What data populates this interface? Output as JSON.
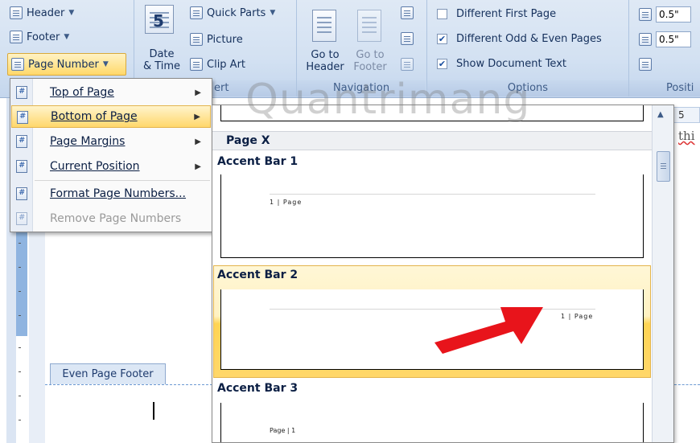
{
  "ribbon": {
    "header_label": "Header",
    "footer_label": "Footer",
    "page_number_label": "Page Number",
    "date_time_label_1": "Date",
    "date_time_label_2": "& Time",
    "date_icon_text": "5",
    "quick_parts_label": "Quick Parts",
    "picture_label": "Picture",
    "clip_art_label": "Clip Art",
    "insert_group_label": "ert",
    "go_to_header_label_1": "Go to",
    "go_to_header_label_2": "Header",
    "go_to_footer_label_1": "Go to",
    "go_to_footer_label_2": "Footer",
    "navigation_group_label": "Navigation",
    "options": [
      {
        "label": "Different First Page",
        "checked": false
      },
      {
        "label": "Different Odd & Even Pages",
        "checked": true
      },
      {
        "label": "Show Document Text",
        "checked": true
      }
    ],
    "options_group_label": "Options",
    "header_position_value": "0.5\"",
    "footer_position_value": "0.5\"",
    "position_group_label": "Positi"
  },
  "menu": {
    "items": [
      {
        "label": "Top of Page",
        "submenu": true,
        "disabled": false
      },
      {
        "label": "Bottom of Page",
        "submenu": true,
        "disabled": false
      },
      {
        "label": "Page Margins",
        "submenu": true,
        "disabled": false
      },
      {
        "label": "Current Position",
        "submenu": true,
        "disabled": false
      },
      {
        "label": "Format Page Numbers...",
        "submenu": false,
        "disabled": false
      },
      {
        "label": "Remove Page Numbers",
        "submenu": false,
        "disabled": true
      }
    ],
    "arrow_glyph": "▶"
  },
  "gallery": {
    "category": "Page X",
    "styles": [
      {
        "title": "Accent Bar 1",
        "preview_text": "1 | Page"
      },
      {
        "title": "Accent Bar 2",
        "preview_text": "1 | Page"
      },
      {
        "title": "Accent Bar 3",
        "preview_text": "Page | 1"
      }
    ]
  },
  "document": {
    "footer_tab_label": "Even Page Footer",
    "side_text": "thi",
    "ruler_value": "5"
  },
  "watermark": "Quantrimang",
  "colors": {
    "highlight": "#ffd76a",
    "arrow": "#e8141b"
  }
}
